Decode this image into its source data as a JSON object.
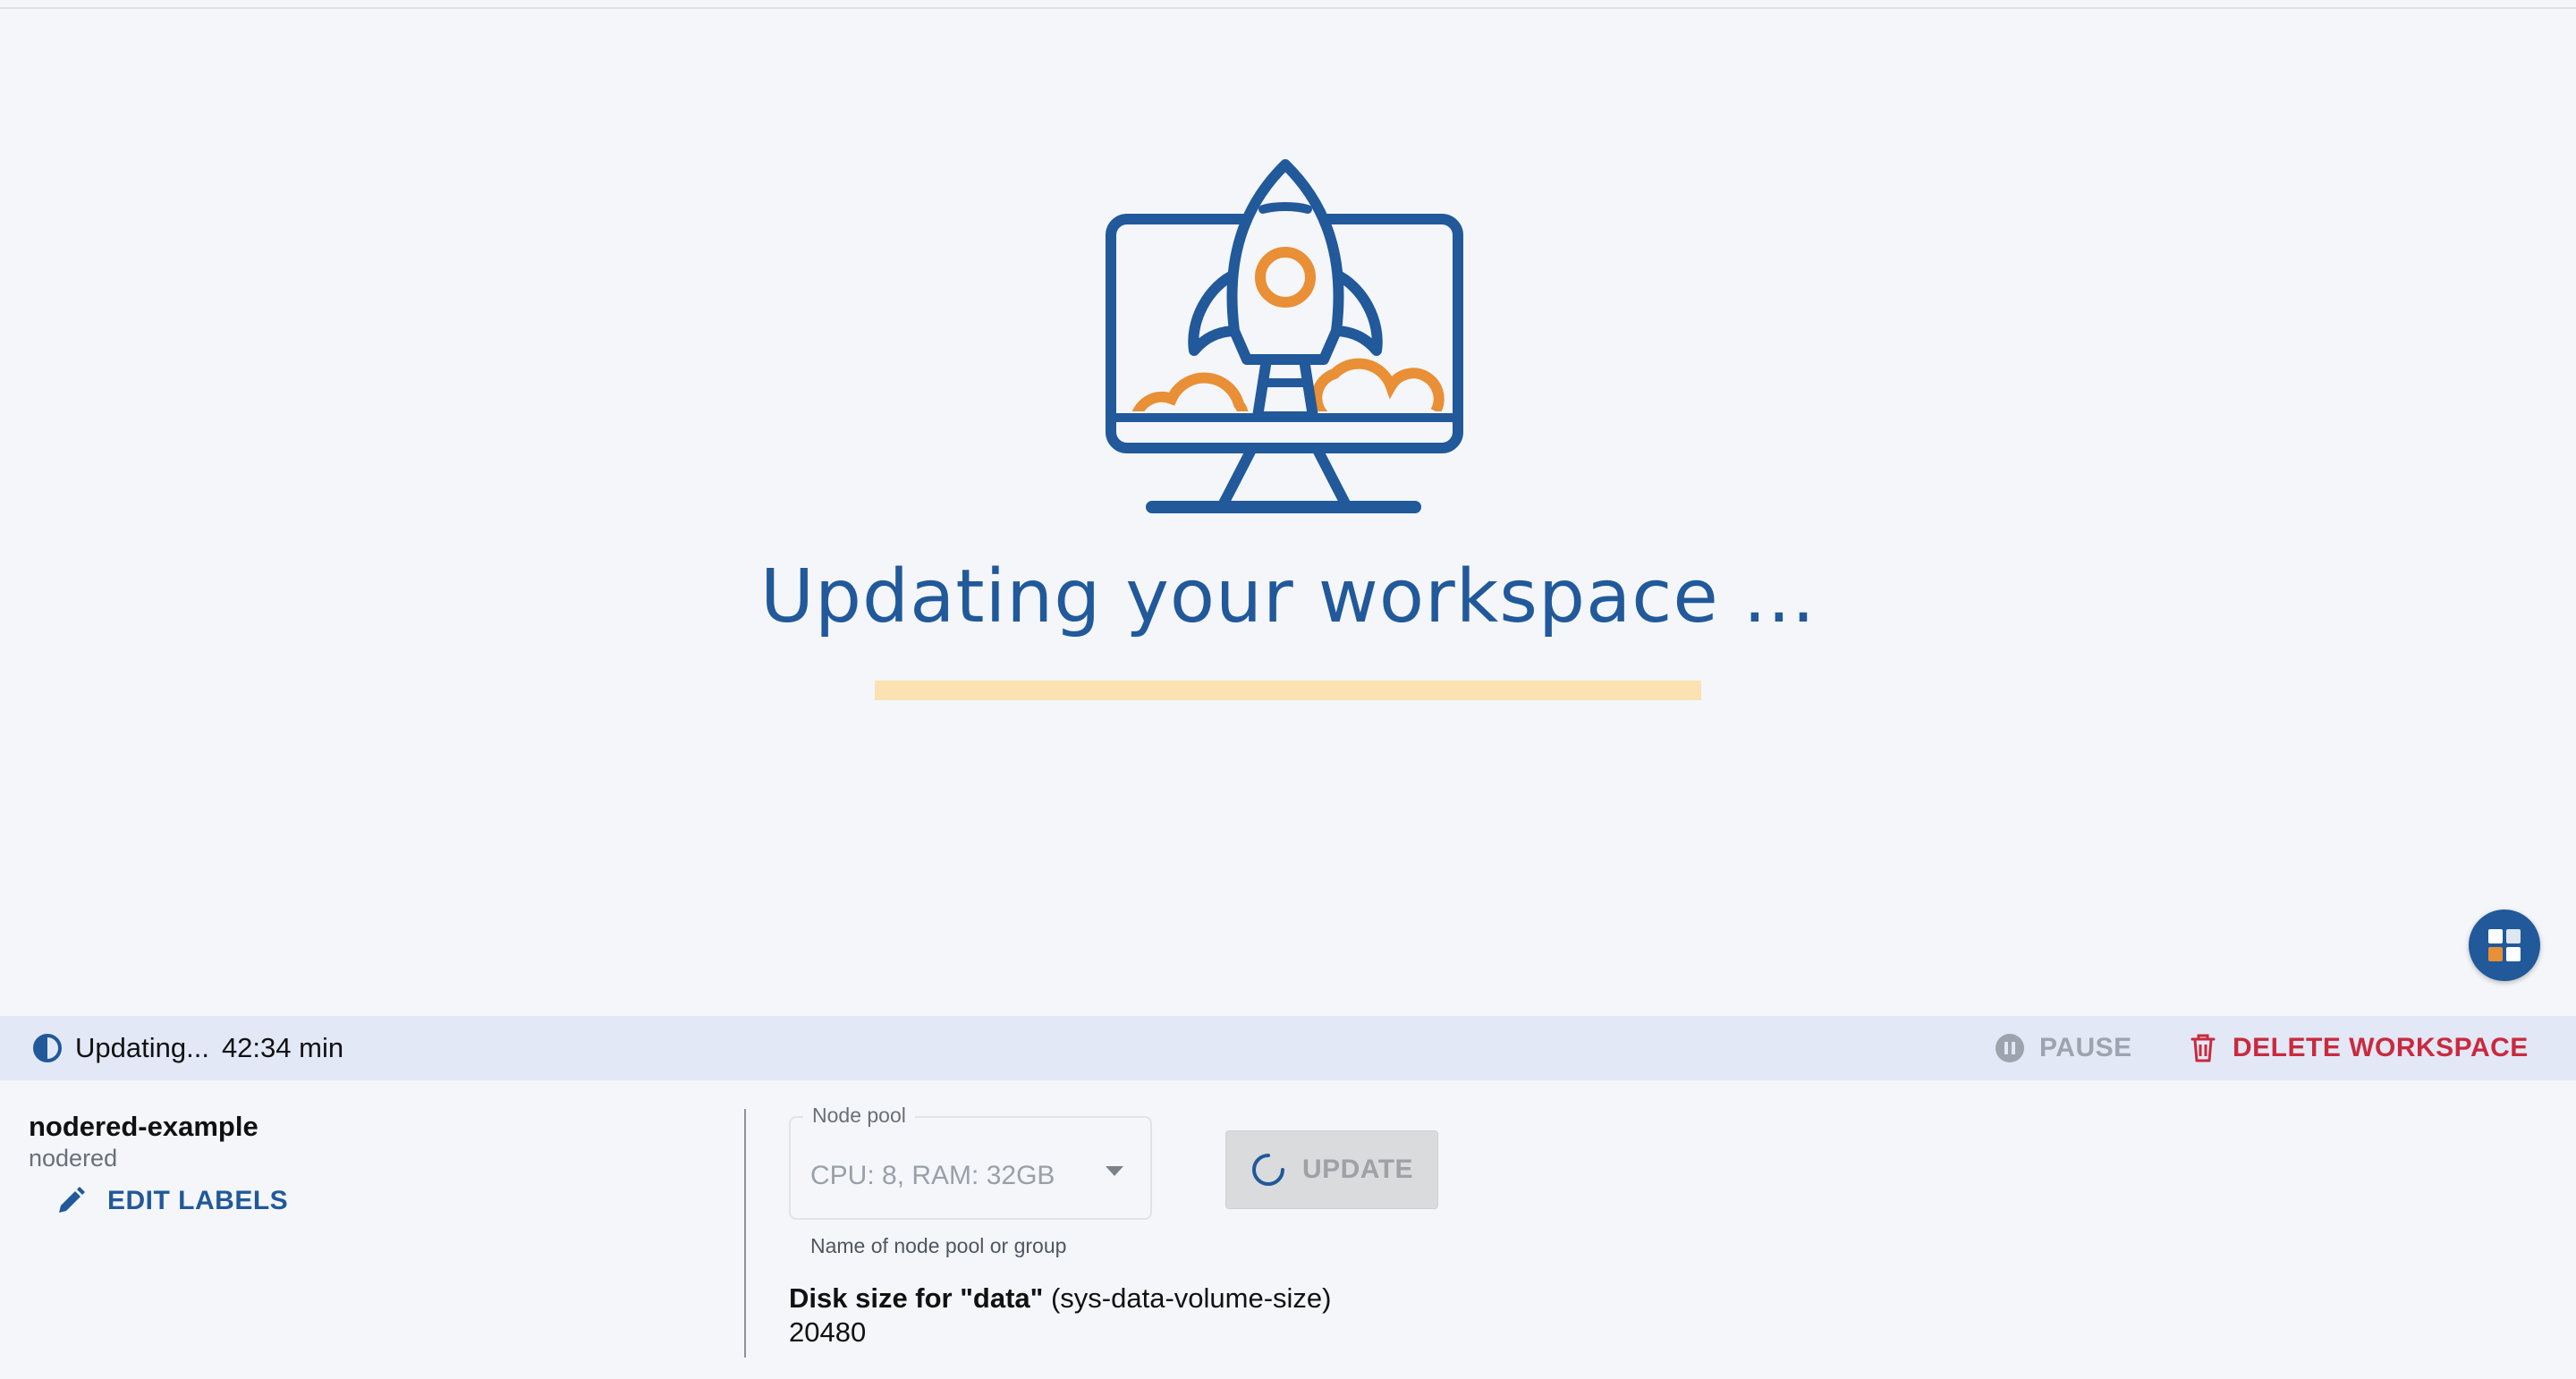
{
  "hero": {
    "headline": "Updating your workspace ...",
    "icon": "rocket-launch-monitor-illustration",
    "progress_fraction": 0.0
  },
  "status_bar": {
    "icon": "half-circle-status-icon",
    "status": "Updating...",
    "elapsed": "42:34 min",
    "pause_label": "PAUSE",
    "delete_label": "DELETE WORKSPACE"
  },
  "workspace": {
    "name": "nodered-example",
    "type": "nodered",
    "edit_labels": "EDIT LABELS"
  },
  "node_pool": {
    "label": "Node pool",
    "value": "CPU: 8, RAM: 32GB",
    "helper": "Name of node pool or group"
  },
  "update_button": {
    "label": "UPDATE"
  },
  "disk": {
    "title": "Disk size for \"data\"",
    "param": " (sys-data-volume-size)",
    "value": "20480"
  },
  "colors": {
    "brand_blue": "#21599a",
    "accent_orange": "#e98f35",
    "danger_red": "#c92a3d",
    "progress_track": "#fce2b2"
  }
}
